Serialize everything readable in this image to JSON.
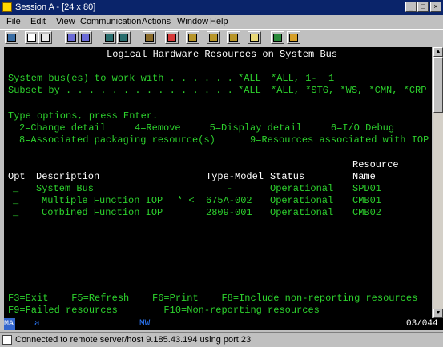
{
  "window": {
    "title": "Session A - [24 x 80]"
  },
  "menu": [
    "File",
    "Edit",
    "View",
    "Communication",
    "Actions",
    "Window",
    "Help"
  ],
  "toolbar_icons": [
    "print-screen-icon",
    "copy-icon",
    "paste-icon",
    "send-icon",
    "receive-icon",
    "display-icon",
    "keyboard-icon",
    "macro-record-icon",
    "macro-stop-icon",
    "macro-play-icon",
    "macro-run-icon",
    "quick-macro-icon",
    "clipboard-icon",
    "color-map-icon",
    "customize-icon"
  ],
  "screen": {
    "heading": "Logical Hardware Resources on System Bus",
    "fields": [
      {
        "label": "System bus(es) to work with . . . . . .",
        "value": "*ALL",
        "hint": "*ALL, 1-  1"
      },
      {
        "label": "Subset by . . . . . . . . . . . . . . .",
        "value": "*ALL",
        "hint": "*ALL, *STG, *WS, *CMN, *CRP"
      }
    ],
    "instructions": "Type options, press Enter.",
    "options_line1": "2=Change detail     4=Remove     5=Display detail     6=I/O Debug",
    "options_line2": "8=Associated packaging resource(s)      9=Resources associated with IOP",
    "headers": {
      "opt": "Opt",
      "description": "Description",
      "type_model": "Type-Model",
      "status": "Status",
      "resource_top": "Resource",
      "resource_bottom": "Name"
    },
    "rows": [
      {
        "opt": "_",
        "description": "System Bus",
        "marker": "",
        "type_model": "-",
        "status": "Operational",
        "name": "SPD01"
      },
      {
        "opt": "_",
        "description": "Multiple Function IOP",
        "marker": "* <",
        "type_model": "675A-002",
        "status": "Operational",
        "name": "CMB01"
      },
      {
        "opt": "_",
        "description": "Combined Function IOP",
        "marker": "",
        "type_model": "2809-001",
        "status": "Operational",
        "name": "CMB02"
      }
    ],
    "fkeys_line1": "F3=Exit    F5=Refresh    F6=Print    F8=Include non-reporting resources",
    "fkeys_line2": "F9=Failed resources        F10=Non-reporting resources"
  },
  "oia": {
    "ma": "MA",
    "a": "a",
    "mw": "MW",
    "position": "03/044"
  },
  "status": {
    "message": "Connected to remote server/host 9.185.43.194 using port 23"
  },
  "colors": {
    "green": "#2dd12d",
    "white": "#ffffff",
    "blue": "#2d7bff",
    "titlebar": "#0a246a"
  }
}
